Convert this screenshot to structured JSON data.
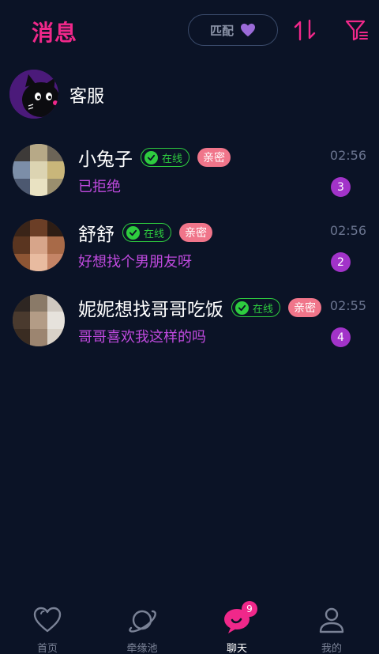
{
  "header": {
    "title": "消息",
    "match_label": "匹配",
    "sort_icon": "sort-icon",
    "filter_icon": "filter-icon"
  },
  "customer_service": {
    "name": "客服"
  },
  "conversations": [
    {
      "name": "小兔子",
      "online": "在线",
      "intimacy": "亲密",
      "message": "已拒绝",
      "time": "02:56",
      "unread": "3"
    },
    {
      "name": "舒舒",
      "online": "在线",
      "intimacy": "亲密",
      "message": "好想找个男朋友呀",
      "time": "02:56",
      "unread": "2"
    },
    {
      "name": "妮妮想找哥哥吃饭",
      "online": "在线",
      "intimacy": "亲密",
      "message": "哥哥喜欢我这样的吗",
      "time": "02:55",
      "unread": "4"
    }
  ],
  "nav": {
    "items": [
      {
        "label": "首页",
        "icon": "heart-icon"
      },
      {
        "label": "牵缘池",
        "icon": "planet-icon"
      },
      {
        "label": "聊天",
        "icon": "chat-icon",
        "badge": "9"
      },
      {
        "label": "我的",
        "icon": "person-icon"
      }
    ]
  },
  "colors": {
    "background": "#0b1326",
    "accent": "#f0288a",
    "message": "#c04adf",
    "online": "#2ecc3f",
    "intimacy": "#f0758a",
    "unread": "#a233c9"
  }
}
